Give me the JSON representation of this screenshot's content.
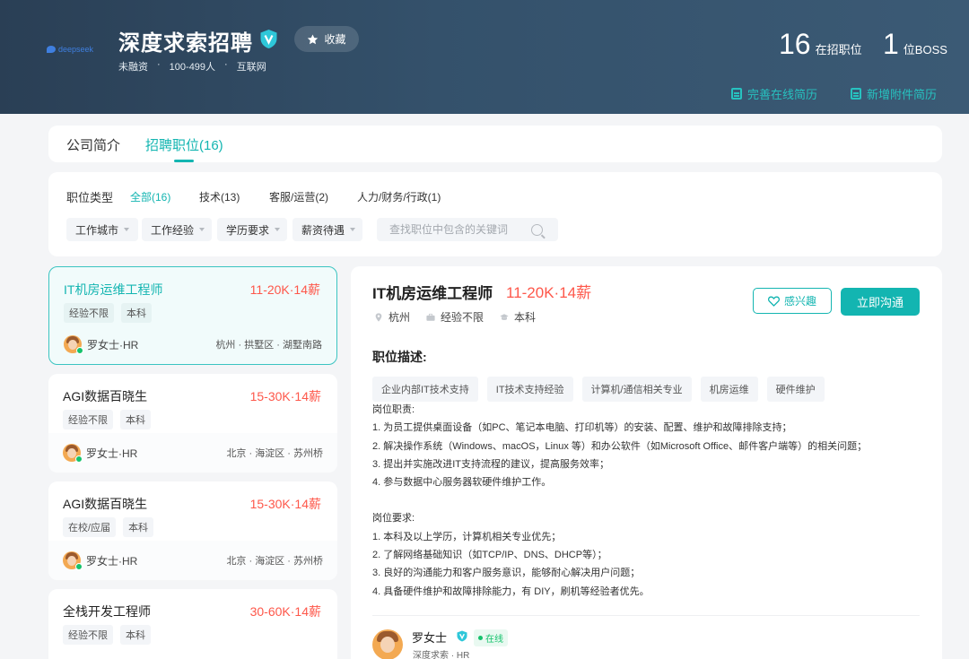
{
  "company": {
    "logo_text": "deepseek",
    "name": "深度求索招聘",
    "favorite_label": "收藏",
    "funding": "未融资",
    "size": "100-499人",
    "industry": "互联网",
    "jobs_count": "16",
    "jobs_label": "在招职位",
    "boss_count": "1",
    "boss_label": "位BOSS",
    "resume_online": "完善在线简历",
    "resume_attach": "新增附件简历"
  },
  "tabs": {
    "intro": "公司简介",
    "jobs": "招聘职位(16)"
  },
  "filters": {
    "type_label": "职位类型",
    "categories": [
      "全部(16)",
      "技术(13)",
      "客服/运营(2)",
      "人力/财务/行政(1)"
    ],
    "dropdowns": [
      "工作城市",
      "工作经验",
      "学历要求",
      "薪资待遇"
    ],
    "search_placeholder": "查找职位中包含的关键词"
  },
  "jobs": [
    {
      "title": "IT机房运维工程师",
      "salary": "11-20K·14薪",
      "tags": [
        "经验不限",
        "本科"
      ],
      "recruiter": "罗女士·HR",
      "location": "杭州 · 拱墅区 · 湖墅南路"
    },
    {
      "title": "AGI数据百晓生",
      "salary": "15-30K·14薪",
      "tags": [
        "经验不限",
        "本科"
      ],
      "recruiter": "罗女士·HR",
      "location": "北京 · 海淀区 · 苏州桥"
    },
    {
      "title": "AGI数据百晓生",
      "salary": "15-30K·14薪",
      "tags": [
        "在校/应届",
        "本科"
      ],
      "recruiter": "罗女士·HR",
      "location": "北京 · 海淀区 · 苏州桥"
    },
    {
      "title": "全栈开发工程师",
      "salary": "30-60K·14薪",
      "tags": [
        "经验不限",
        "本科"
      ],
      "recruiter": "",
      "location": ""
    }
  ],
  "detail": {
    "title": "IT机房运维工程师",
    "salary": "11-20K·14薪",
    "city": "杭州",
    "experience": "经验不限",
    "education": "本科",
    "interest_label": "感兴趣",
    "chat_label": "立即沟通",
    "desc_title": "职位描述:",
    "skills": [
      "企业内部IT技术支持",
      "IT技术支持经验",
      "计算机/通信相关专业",
      "机房运维",
      "硬件维护"
    ],
    "duties_title": "岗位职责:",
    "duties": [
      "1. 为员工提供桌面设备（如PC、笔记本电脑、打印机等）的安装、配置、维护和故障排除支持；",
      "2. 解决操作系统（Windows、macOS，Linux 等）和办公软件（如Microsoft Office、邮件客户端等）的相关问题；",
      "3. 提出并实施改进IT支持流程的建议，提高服务效率；",
      "4. 参与数据中心服务器软硬件维护工作。"
    ],
    "req_title": "岗位要求:",
    "requirements": [
      "1. 本科及以上学历，计算机相关专业优先；",
      "2. 了解网络基础知识（如TCP/IP、DNS、DHCP等）；",
      "3. 良好的沟通能力和客户服务意识，能够耐心解决用户问题；",
      "4. 具备硬件维护和故障排除能力，有 DIY，刷机等经验者优先。"
    ],
    "hr_name": "罗女士",
    "hr_status": "在线",
    "hr_company": "深度求索 · HR"
  },
  "colors": {
    "accent": "#13b5b1",
    "salary": "#fe574a",
    "banner": "#34516b"
  }
}
